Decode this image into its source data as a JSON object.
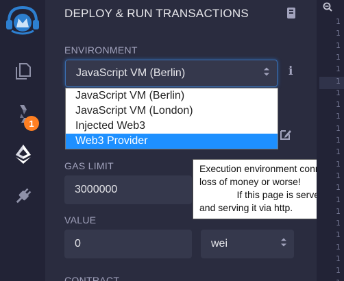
{
  "rail": {
    "icons": [
      "remix-logo-icon",
      "file-explorer-icon",
      "solidity-compiler-icon",
      "ethereum-deploy-icon",
      "plugin-manager-icon"
    ],
    "compiler_badge": "1"
  },
  "panel": {
    "title": "DEPLOY & RUN TRANSACTIONS",
    "environment": {
      "label": "ENVIRONMENT",
      "selected": "JavaScript VM (Berlin)",
      "options": [
        "JavaScript VM (Berlin)",
        "JavaScript VM (London)",
        "Injected Web3",
        "Web3 Provider"
      ],
      "highlighted": "Web3 Provider"
    },
    "gas_limit": {
      "label": "GAS LIMIT",
      "value": "3000000"
    },
    "value": {
      "label": "VALUE",
      "amount": "0",
      "unit": "wei"
    },
    "contract": {
      "label": "CONTRACT"
    },
    "tooltip": "Execution environment conne\nloss of money or worse!\n              If this page is served\nand serving it via http."
  },
  "editor": {
    "line_numbers": [
      "1",
      "1",
      "1",
      "1",
      "1",
      "1",
      "1",
      "1",
      "1",
      "1",
      "1",
      "1",
      "1",
      "1",
      "1",
      "1",
      "1",
      "1",
      "1",
      "1",
      "1",
      "1",
      "1"
    ]
  },
  "colors": {
    "accent": "#1e90ff",
    "badge": "#ff7f22",
    "rail": "#222336",
    "panel": "#2a2c3f"
  }
}
